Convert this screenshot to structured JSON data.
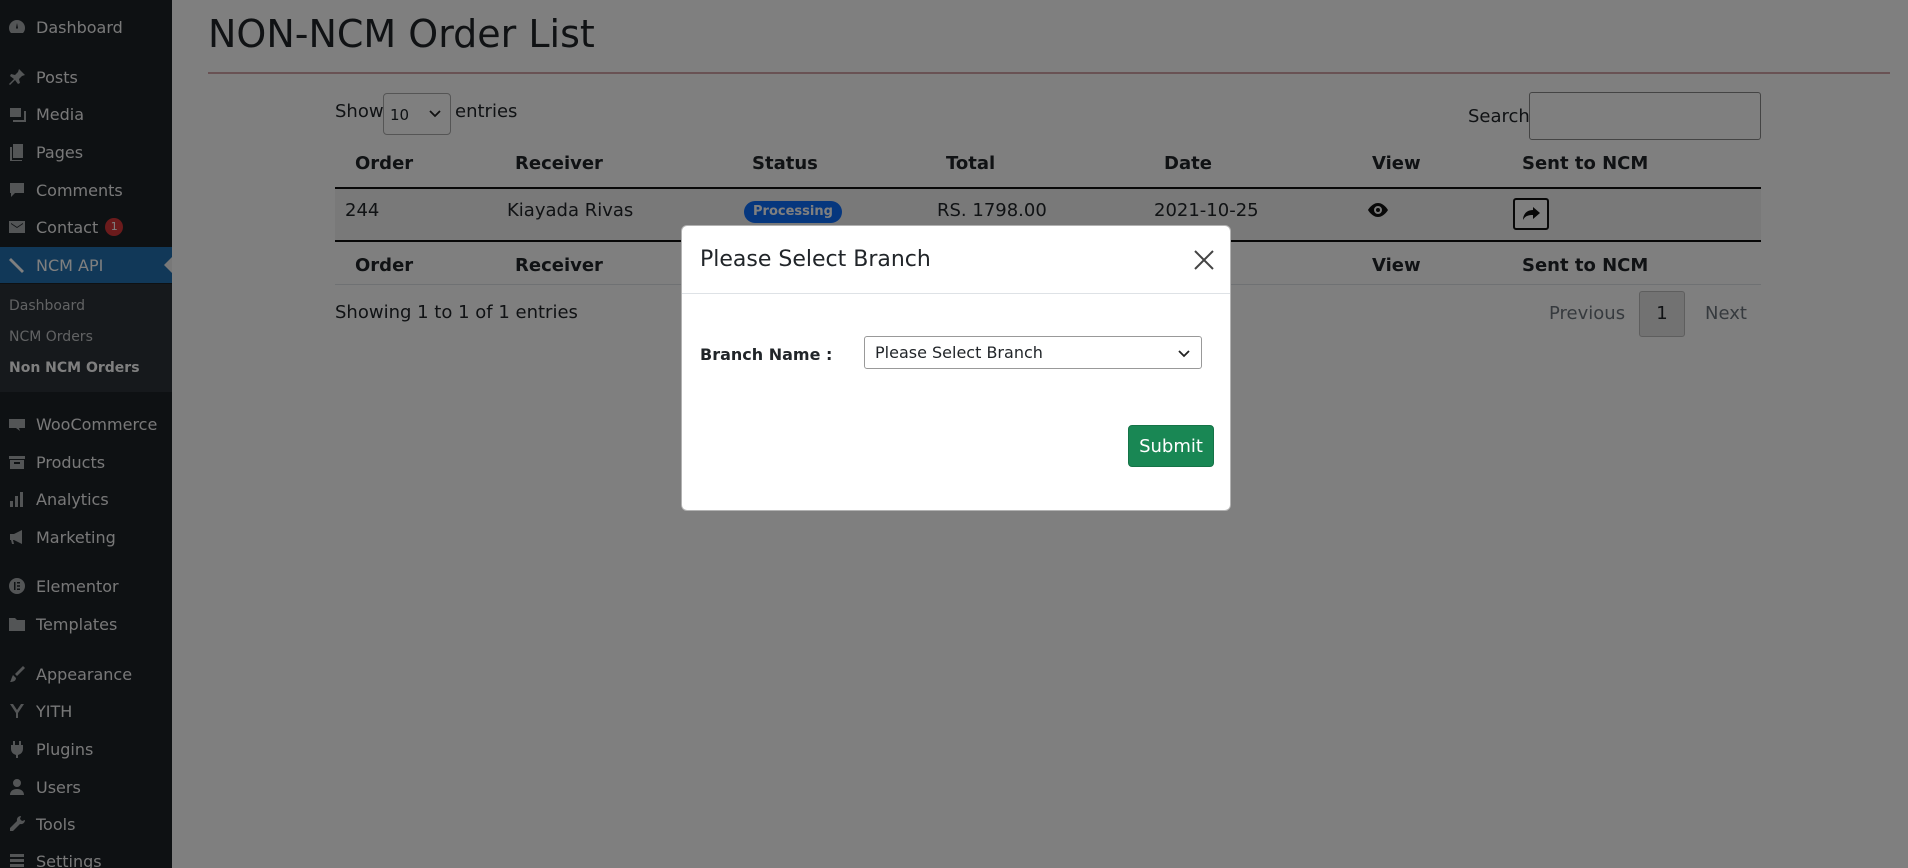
{
  "sidebar": {
    "items": [
      {
        "label": "Dashboard",
        "icon": "dashboard-icon"
      },
      {
        "label": "Posts",
        "icon": "pin-icon"
      },
      {
        "label": "Media",
        "icon": "media-icon"
      },
      {
        "label": "Pages",
        "icon": "pages-icon"
      },
      {
        "label": "Comments",
        "icon": "comment-icon"
      },
      {
        "label": "Contact",
        "icon": "mail-icon",
        "badge": "1"
      },
      {
        "label": "NCM API",
        "icon": "ncm-api-icon",
        "active": true
      },
      {
        "label": "WooCommerce",
        "icon": "woocommerce-icon"
      },
      {
        "label": "Products",
        "icon": "products-icon"
      },
      {
        "label": "Analytics",
        "icon": "analytics-icon"
      },
      {
        "label": "Marketing",
        "icon": "megaphone-icon"
      },
      {
        "label": "Elementor",
        "icon": "elementor-icon"
      },
      {
        "label": "Templates",
        "icon": "folder-icon"
      },
      {
        "label": "Appearance",
        "icon": "brush-icon"
      },
      {
        "label": "YITH",
        "icon": "yith-icon"
      },
      {
        "label": "Plugins",
        "icon": "plugin-icon"
      },
      {
        "label": "Users",
        "icon": "user-icon"
      },
      {
        "label": "Tools",
        "icon": "wrench-icon"
      },
      {
        "label": "Settings",
        "icon": "settings-icon"
      }
    ],
    "submenu": [
      {
        "label": "Dashboard"
      },
      {
        "label": "NCM Orders"
      },
      {
        "label": "Non NCM Orders",
        "current": true
      }
    ]
  },
  "page": {
    "title": "NON-NCM Order List"
  },
  "table_controls": {
    "show_label": "Show",
    "entries_label": "entries",
    "length_value": "10",
    "search_label": "Search:",
    "search_value": ""
  },
  "table": {
    "columns": [
      "Order",
      "Receiver",
      "Status",
      "Total",
      "Date",
      "View",
      "Sent to NCM"
    ],
    "rows": [
      {
        "order": "244",
        "receiver": "Kiayada Rivas",
        "status": "Processing",
        "total": "RS. 1798.00",
        "date": "2021-10-25"
      }
    ],
    "info": "Showing 1 to 1 of 1 entries",
    "pagination": {
      "previous": "Previous",
      "current": "1",
      "next": "Next"
    }
  },
  "modal": {
    "title": "Please Select Branch",
    "branch_label": "Branch Name :",
    "branch_select_value": "Please Select Branch",
    "submit_label": "Submit"
  },
  "colors": {
    "sidebar_bg": "#1d2327",
    "sidebar_active": "#2271b1",
    "status_badge": "#0d6efd",
    "submit_button": "#198754",
    "badge_red": "#d63638"
  }
}
